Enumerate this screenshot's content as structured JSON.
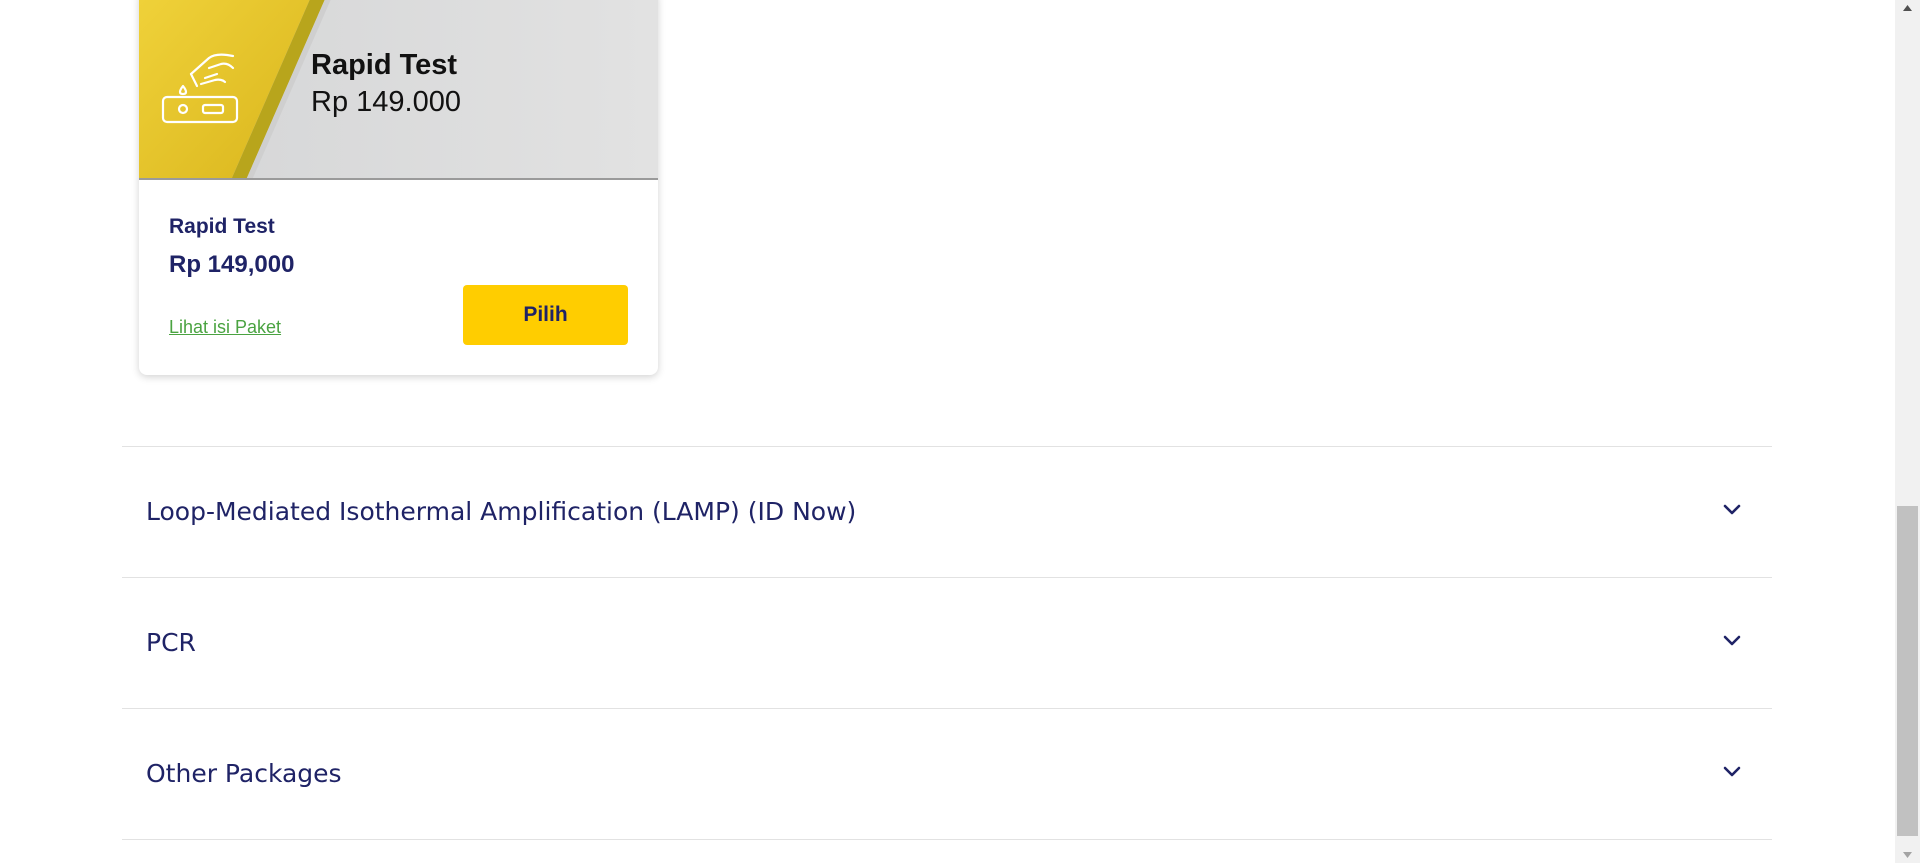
{
  "product_card": {
    "banner": {
      "title": "Rapid Test",
      "price": "Rp 149.000",
      "icon": "rapid-test-kit-icon",
      "colors": {
        "yellow": "#e9c92f",
        "gray": "#dcdcdc"
      }
    },
    "name": "Rapid Test",
    "price": "Rp 149,000",
    "details_link": "Lihat isi Paket",
    "select_label": "Pilih"
  },
  "accordion": {
    "items": [
      {
        "title": "Loop-Mediated Isothermal Amplification (LAMP) (ID Now)",
        "icon": "chevron-down-icon"
      },
      {
        "title": "PCR",
        "icon": "chevron-down-icon"
      },
      {
        "title": "Other Packages",
        "icon": "chevron-down-icon"
      }
    ]
  },
  "colors": {
    "heading": "#1f2366",
    "link": "#4aa341",
    "button": "#ffcd00",
    "divider": "#e2e2e2"
  }
}
